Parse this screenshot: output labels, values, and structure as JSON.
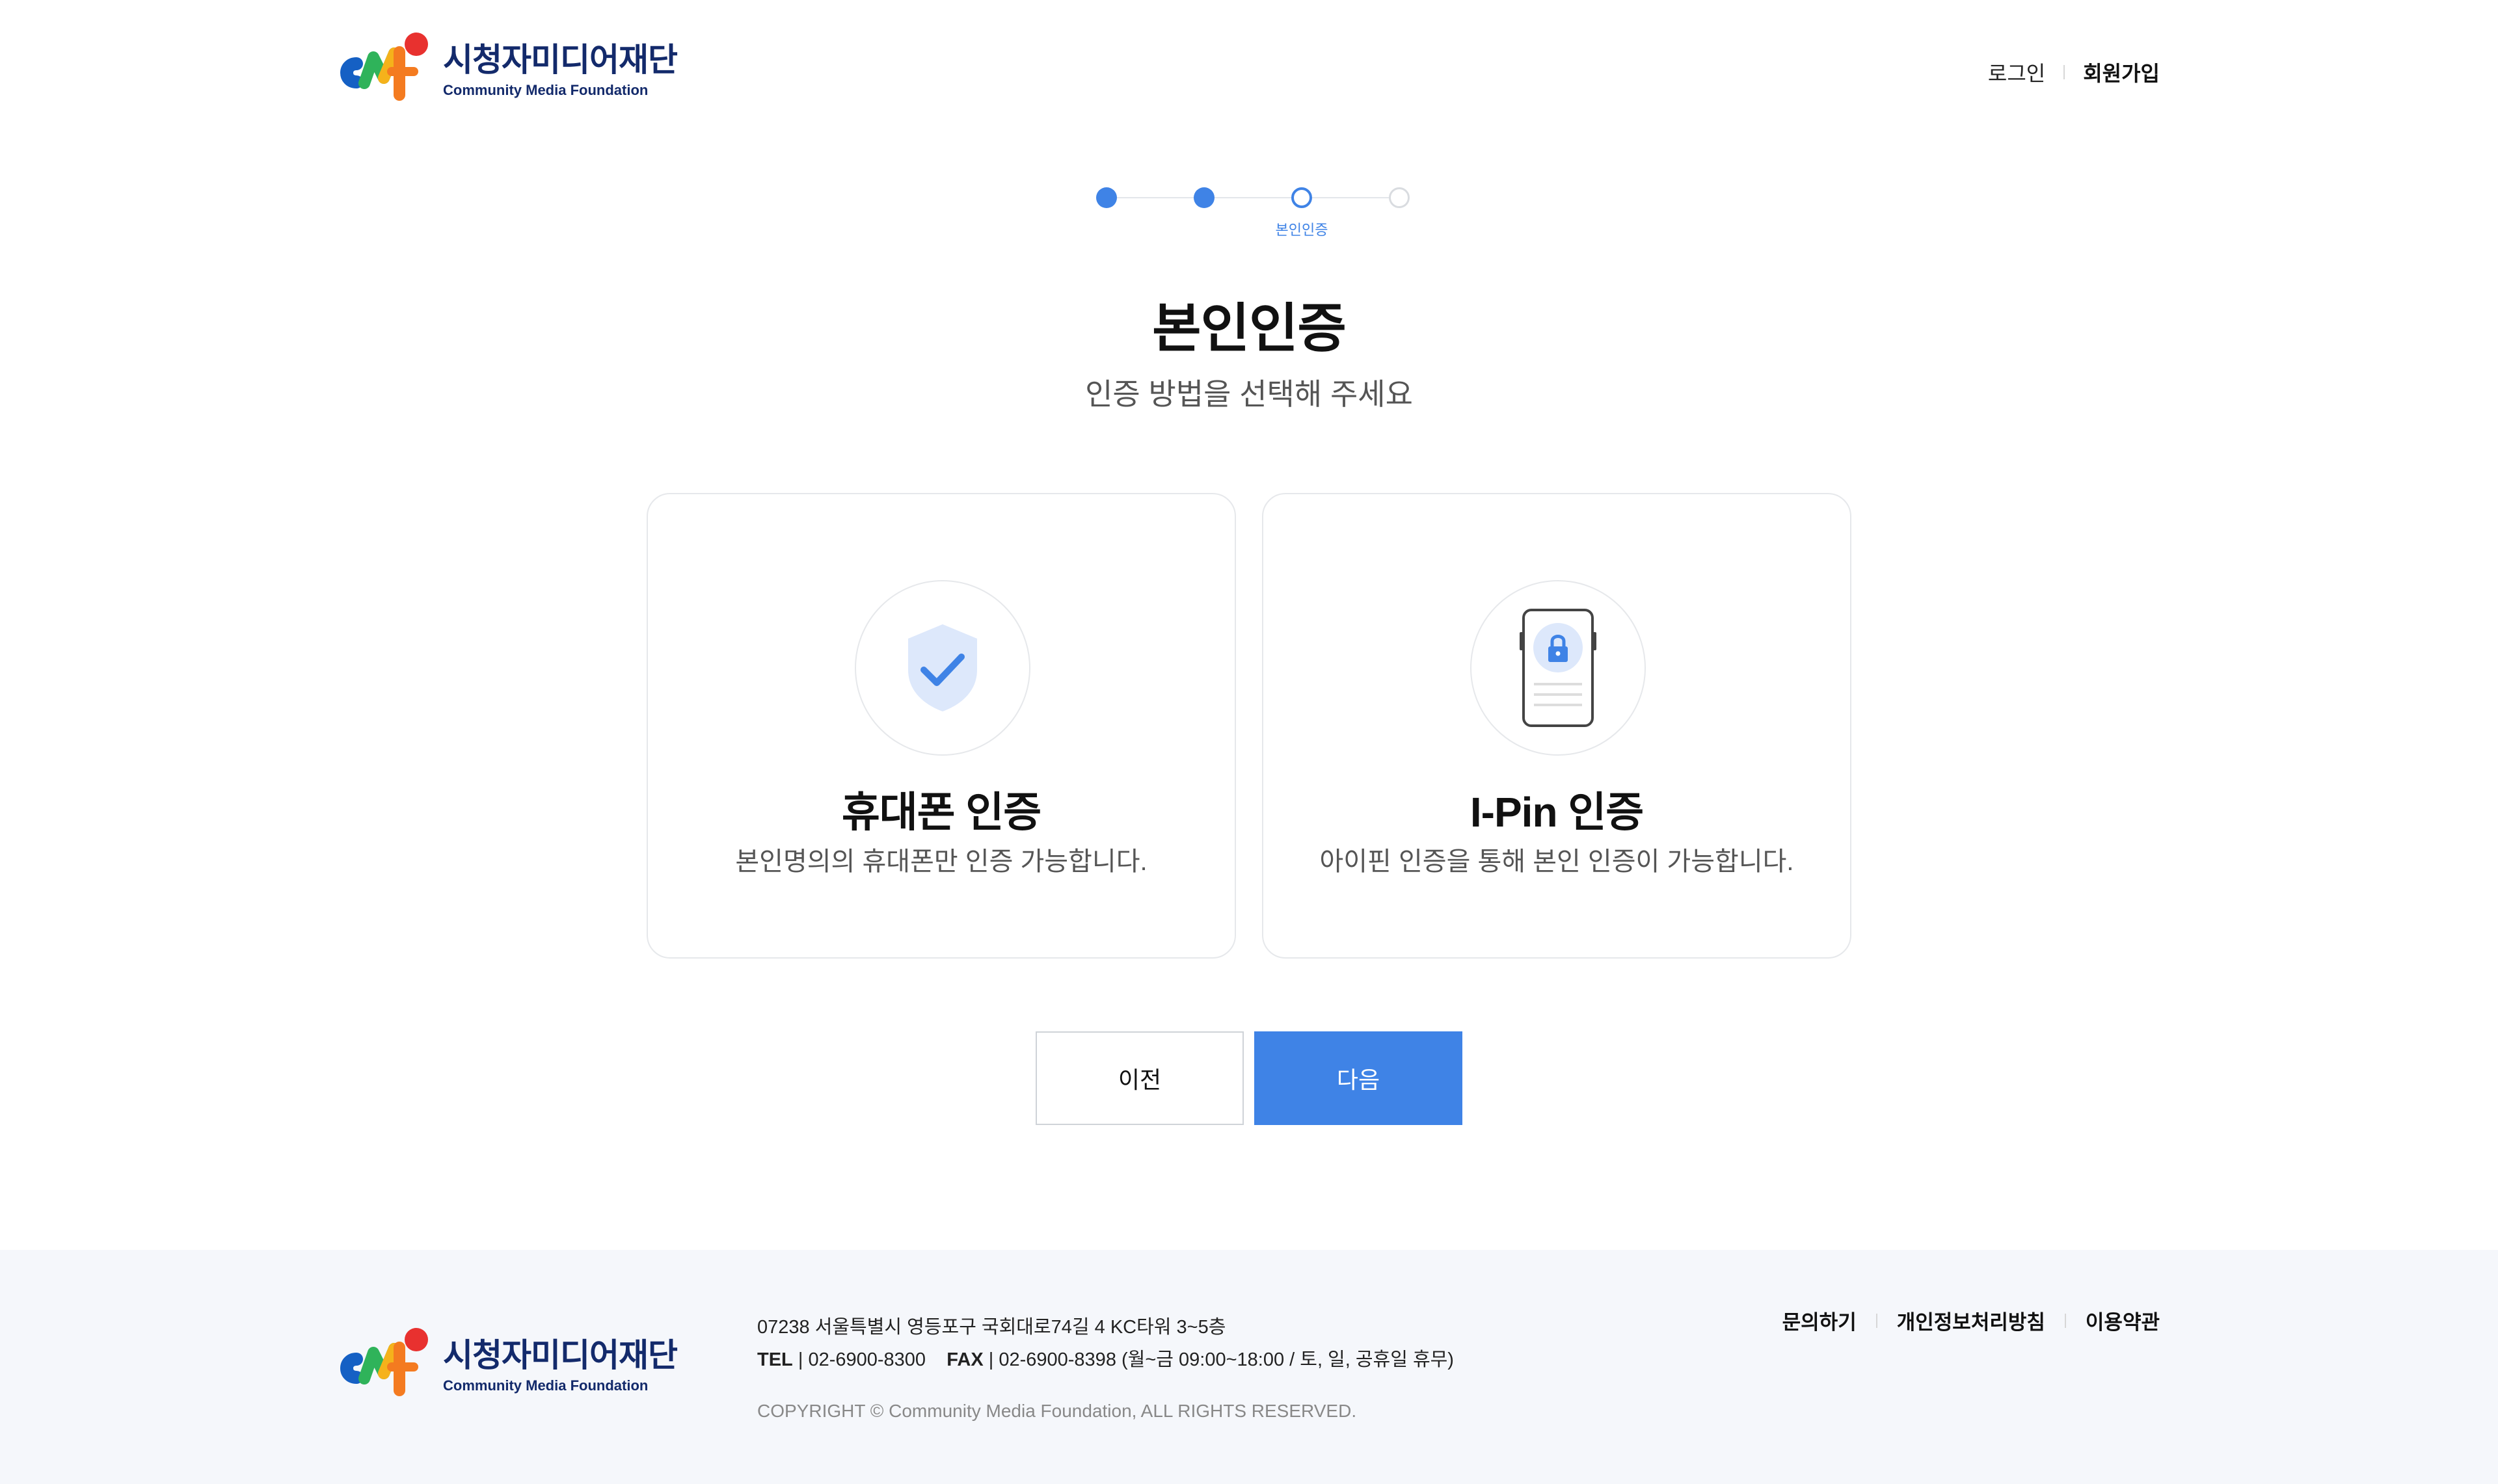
{
  "brand": {
    "name_ko": "시청자미디어재단",
    "name_en": "Community Media Foundation"
  },
  "header": {
    "links": [
      "로그인",
      "회원가입"
    ]
  },
  "stepper": {
    "current_label": "본인인증",
    "total_steps": 4,
    "current_step": 3
  },
  "page": {
    "title": "본인인증",
    "subtitle": "인증 방법을 선택해 주세요"
  },
  "options": [
    {
      "title": "휴대폰 인증",
      "desc": "본인명의의 휴대폰만 인증 가능합니다.",
      "icon": "shield-check-icon"
    },
    {
      "title": "I-Pin 인증",
      "desc": "아이핀 인증을 통해 본인 인증이 가능합니다.",
      "icon": "phone-lock-icon"
    }
  ],
  "buttons": {
    "prev": "이전",
    "next": "다음"
  },
  "footer": {
    "address": "07238 서울특별시 영등포구 국회대로74길 4 KC타워 3~5층",
    "tel_label": "TEL",
    "tel": "02-6900-8300",
    "fax_label": "FAX",
    "fax": "02-6900-8398 (월~금 09:00~18:00 / 토, 일, 공휴일 휴무)",
    "copyright": "COPYRIGHT © Community Media Foundation, ALL RIGHTS RESERVED.",
    "links": [
      "문의하기",
      "개인정보처리방침",
      "이용약관"
    ]
  },
  "colors": {
    "accent": "#3f83e6",
    "footer_bg": "#f5f7fb",
    "brand_navy": "#132a6b"
  }
}
